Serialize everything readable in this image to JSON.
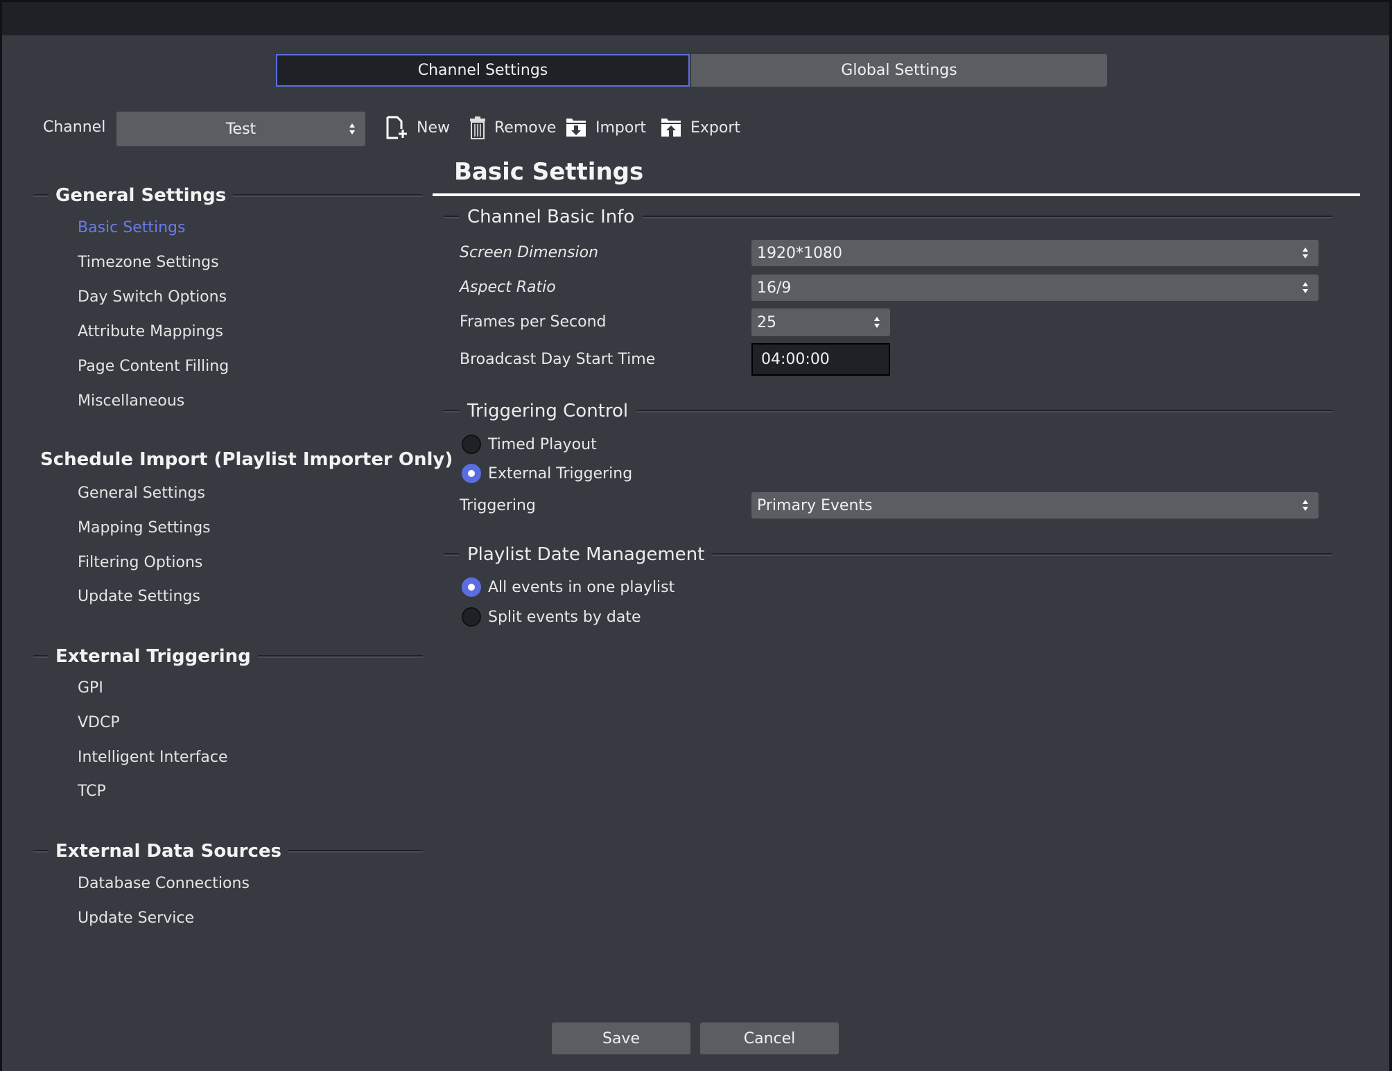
{
  "tabs": [
    {
      "label": "Channel Settings",
      "active": true
    },
    {
      "label": "Global Settings",
      "active": false
    }
  ],
  "toolbar": {
    "channel_label": "Channel",
    "channel_value": "Test",
    "new_label": "New",
    "remove_label": "Remove",
    "import_label": "Import",
    "export_label": "Export"
  },
  "sidebar": {
    "sections": [
      {
        "title": "General Settings",
        "items": [
          "Basic Settings",
          "Timezone Settings",
          "Day Switch Options",
          "Attribute Mappings",
          "Page Content Filling",
          "Miscellaneous"
        ]
      },
      {
        "title": "Schedule Import (Playlist Importer Only)",
        "items": [
          "General Settings",
          "Mapping Settings",
          "Filtering Options",
          "Update Settings"
        ]
      },
      {
        "title": "External Triggering",
        "items": [
          "GPI",
          "VDCP",
          "Intelligent Interface",
          "TCP"
        ]
      },
      {
        "title": "External Data Sources",
        "items": [
          "Database Connections",
          "Update Service"
        ]
      }
    ],
    "active_item": "Basic Settings"
  },
  "main": {
    "title": "Basic Settings",
    "channel_basic_info": {
      "title": "Channel Basic Info",
      "screen_dimension_label": "Screen Dimension",
      "screen_dimension_value": "1920*1080",
      "aspect_ratio_label": "Aspect Ratio",
      "aspect_ratio_value": "16/9",
      "fps_label": "Frames per Second",
      "fps_value": "25",
      "day_start_label": "Broadcast Day Start Time",
      "day_start_value": "04:00:00"
    },
    "triggering_control": {
      "title": "Triggering Control",
      "options": [
        {
          "label": "Timed Playout",
          "selected": false
        },
        {
          "label": "External Triggering",
          "selected": true
        }
      ],
      "triggering_label": "Triggering",
      "triggering_value": "Primary Events"
    },
    "playlist_date": {
      "title": "Playlist Date Management",
      "options": [
        {
          "label": "All events in one playlist",
          "selected": true
        },
        {
          "label": "Split events by date",
          "selected": false
        }
      ]
    }
  },
  "footer": {
    "save_label": "Save",
    "cancel_label": "Cancel"
  },
  "colors": {
    "accent": "#5b6ee1",
    "background": "#373a40",
    "titlebar": "#1f2126",
    "control": "#5a5e62"
  }
}
